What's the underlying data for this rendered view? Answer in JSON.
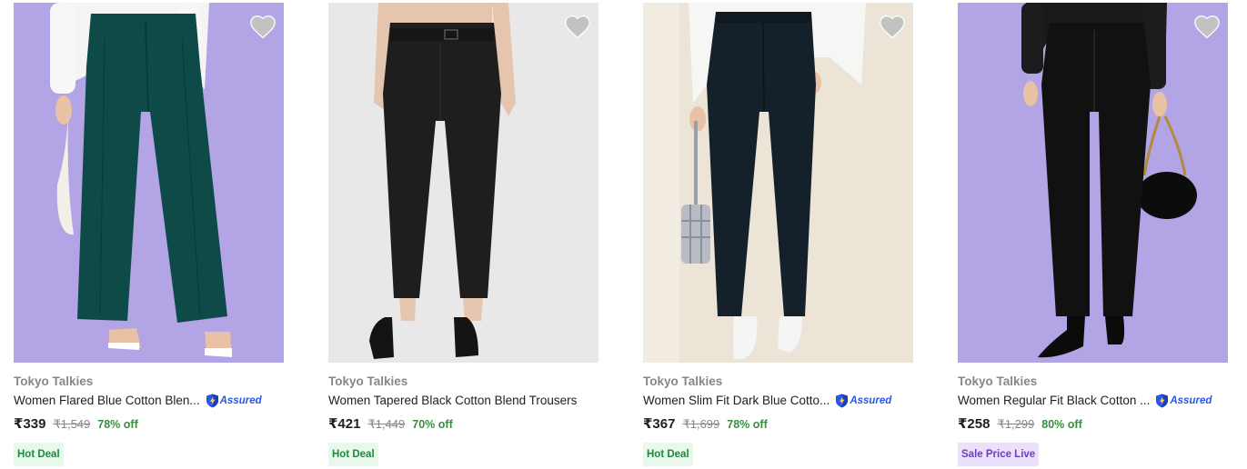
{
  "products": [
    {
      "brand": "Tokyo Talkies",
      "title": "Women Flared Blue Cotton Blen...",
      "assured": "Assured",
      "price": "₹339",
      "mrp": "₹1,549",
      "discount": "78% off",
      "badge": "Hot Deal",
      "badge_type": "hot",
      "bg_color": "#b3a4e6",
      "pant_color": "#0d4a48"
    },
    {
      "brand": "Tokyo Talkies",
      "title": "Women Tapered Black Cotton Blend Trousers",
      "assured": "",
      "price": "₹421",
      "mrp": "₹1,449",
      "discount": "70% off",
      "badge": "Hot Deal",
      "badge_type": "hot",
      "bg_color": "#e8e8e8",
      "pant_color": "#1e1e1e"
    },
    {
      "brand": "Tokyo Talkies",
      "title": "Women Slim Fit Dark Blue Cotto...",
      "assured": "Assured",
      "price": "₹367",
      "mrp": "₹1,699",
      "discount": "78% off",
      "badge": "Hot Deal",
      "badge_type": "hot",
      "bg_color": "#ece4d6",
      "pant_color": "#14202a"
    },
    {
      "brand": "Tokyo Talkies",
      "title": "Women Regular Fit Black Cotton ...",
      "assured": "Assured",
      "price": "₹258",
      "mrp": "₹1,299",
      "discount": "80% off",
      "badge": "Sale Price Live",
      "badge_type": "sale",
      "bg_color": "#b3a4e6",
      "pant_color": "#111111"
    }
  ]
}
